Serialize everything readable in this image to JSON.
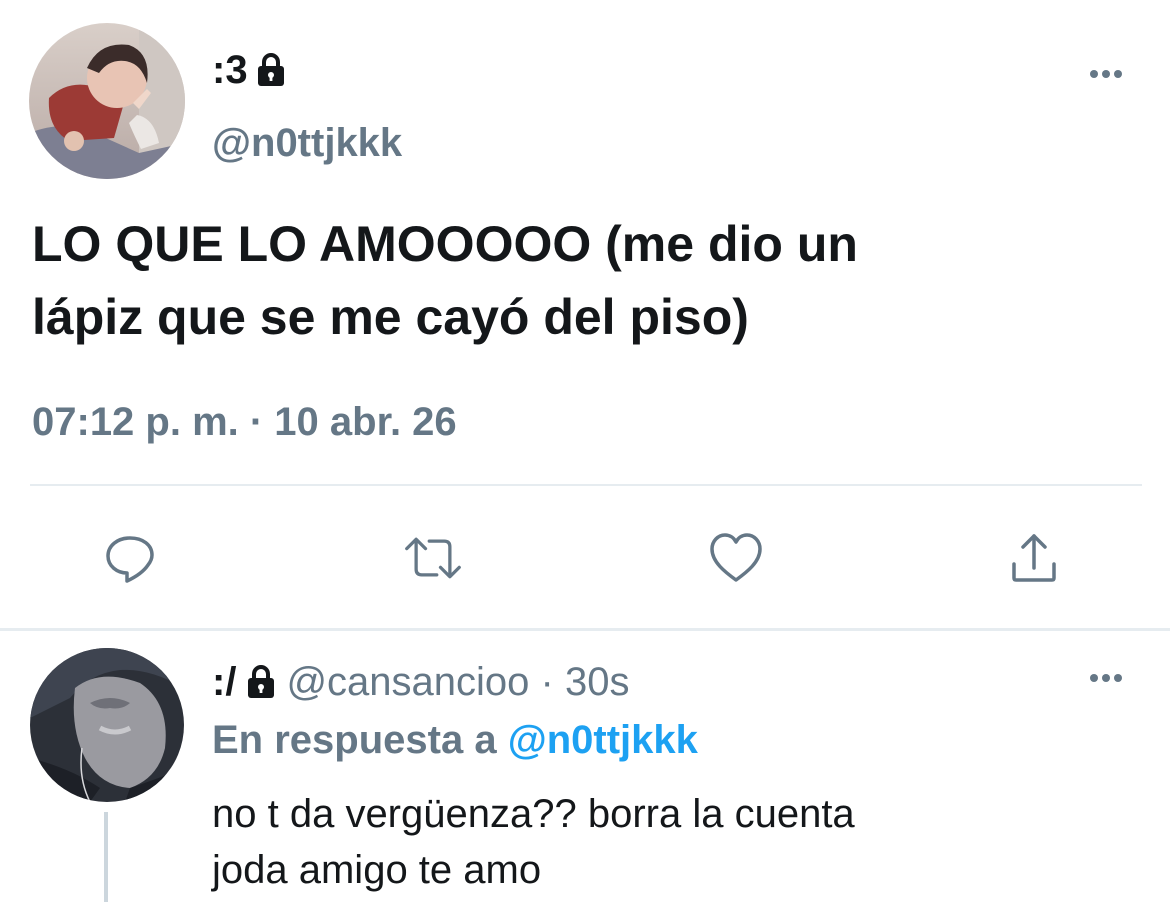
{
  "main_tweet": {
    "display_name": ":3",
    "handle": "@n0ttjkkk",
    "text_line1": "LO QUE LO AMOOOOO (me dio un",
    "text_line2": "lápiz que se me cayó del piso)",
    "timestamp": "07:12 p. m. · 10 abr. 26",
    "avatar_icon": "avatar-photo-child",
    "lock_icon": "lock-icon",
    "more_icon": "more-horizontal-icon"
  },
  "actions": {
    "reply_icon": "reply-icon",
    "retweet_icon": "retweet-icon",
    "like_icon": "heart-icon",
    "share_icon": "share-icon"
  },
  "reply": {
    "display_name": ":/",
    "meta": "@cansancioo · 30s",
    "reply_to_label": "En respuesta a",
    "reply_to_handle": "@n0ttjkkk",
    "text_line1": "no t da vergüenza?? borra la cuenta",
    "text_line2": "joda amigo te amo",
    "avatar_icon": "avatar-photo-face"
  },
  "colors": {
    "text_primary": "#14171a",
    "text_secondary": "#657786",
    "link": "#1da1f2",
    "divider": "#e6ecf0"
  }
}
